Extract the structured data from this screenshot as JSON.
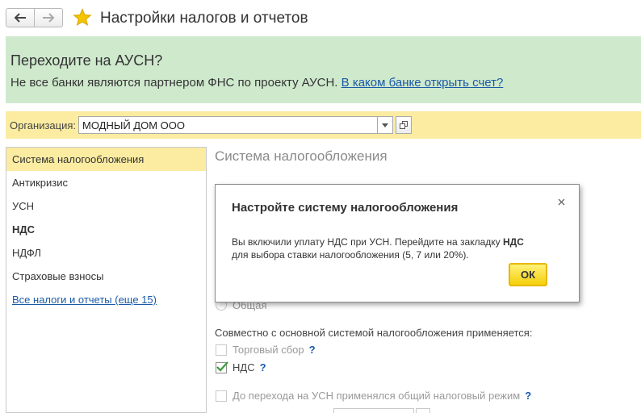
{
  "header": {
    "title": "Настройки налогов и отчетов"
  },
  "banner": {
    "title": "Переходите на АУСН?",
    "text": "Не все банки являются партнером ФНС по проекту АУСН. ",
    "link": "В каком банке открыть счет?",
    "background": "#cfe9cd"
  },
  "org": {
    "label": "Организация:",
    "value": "МОДНЫЙ ДОМ ООО"
  },
  "sidebar": {
    "items": [
      {
        "label": "Система налогообложения"
      },
      {
        "label": "Антикризис"
      },
      {
        "label": "УСН"
      },
      {
        "label": "НДС"
      },
      {
        "label": "НДФЛ"
      },
      {
        "label": "Страховые взносы"
      },
      {
        "label": "Все налоги и отчеты (еще 15)"
      }
    ]
  },
  "content": {
    "section_title": "Система налогообложения",
    "radio_general_label": "Общая",
    "combined_label": "Совместно с основной системой налогообложения применяется:",
    "checkboxes": [
      {
        "label": "Торговый сбор",
        "help": "?",
        "checked": false
      },
      {
        "label": "НДС",
        "help": "?",
        "checked": true
      },
      {
        "label": "До перехода на УСН применялся общий налоговый режим",
        "help": "?",
        "checked": false
      }
    ]
  },
  "dialog": {
    "title": "Настройте систему налогообложения",
    "line1_before": "Вы включили уплату НДС при УСН. Перейдите на закладку ",
    "line1_bold": "НДС",
    "line2": "для выбора ставки налогообложения (5, 7 или 20%).",
    "ok_label": "ОК"
  },
  "colors": {
    "accent_yellow": "#fbeca1",
    "link": "#1a5aa6",
    "ok_button": "#f5cf0a",
    "star": "#f5c400",
    "checkmark": "#3a9b3a"
  }
}
